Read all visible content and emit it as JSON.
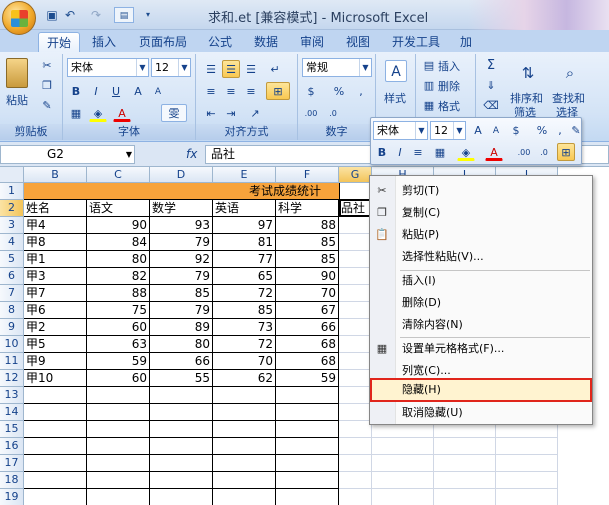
{
  "window": {
    "title": "求和.et  [兼容模式] - Microsoft Excel"
  },
  "quick_access": {
    "icons": [
      "save-icon",
      "undo-icon",
      "redo-icon",
      "customize-icon"
    ]
  },
  "tabs": [
    {
      "label": "开始",
      "active": true
    },
    {
      "label": "插入"
    },
    {
      "label": "页面布局"
    },
    {
      "label": "公式"
    },
    {
      "label": "数据"
    },
    {
      "label": "审阅"
    },
    {
      "label": "视图"
    },
    {
      "label": "开发工具"
    },
    {
      "label": "加"
    }
  ],
  "ribbon": {
    "clipboard": {
      "paste_label": "粘贴",
      "group_label": "剪贴板"
    },
    "font": {
      "name": "宋体",
      "size": "12",
      "group_label": "字体"
    },
    "alignment": {
      "group_label": "对齐方式"
    },
    "number": {
      "format": "常规",
      "group_label": "数字"
    },
    "styles": {
      "label": "样式"
    },
    "cells": {
      "insert": "插入",
      "delete": "删除",
      "format": "格式"
    },
    "editing": {
      "sort": "排序和",
      "sort2": "筛选",
      "find": "查找和",
      "find2": "选择"
    }
  },
  "formula_bar": {
    "name_box": "G2",
    "fx": "fx",
    "content": "品社"
  },
  "columns": [
    "B",
    "C",
    "D",
    "E",
    "F",
    "G",
    "H",
    "I",
    "J"
  ],
  "rows": [
    "1",
    "2",
    "3",
    "4",
    "5",
    "6",
    "7",
    "8",
    "9",
    "10",
    "11",
    "12",
    "13",
    "14",
    "15",
    "16",
    "17",
    "18",
    "19"
  ],
  "sheet": {
    "title": "考试成绩统计",
    "headers": [
      "姓名",
      "语文",
      "数学",
      "英语",
      "科学",
      "品社"
    ],
    "records": [
      [
        "甲4",
        "90",
        "93",
        "97",
        "88"
      ],
      [
        "甲8",
        "84",
        "79",
        "81",
        "85"
      ],
      [
        "甲1",
        "80",
        "92",
        "77",
        "85"
      ],
      [
        "甲3",
        "82",
        "79",
        "65",
        "90"
      ],
      [
        "甲7",
        "88",
        "85",
        "72",
        "70"
      ],
      [
        "甲6",
        "75",
        "79",
        "85",
        "67"
      ],
      [
        "甲2",
        "60",
        "89",
        "73",
        "66"
      ],
      [
        "甲5",
        "63",
        "80",
        "72",
        "68"
      ],
      [
        "甲9",
        "59",
        "66",
        "70",
        "68"
      ],
      [
        "甲10",
        "60",
        "55",
        "62",
        "59"
      ]
    ]
  },
  "mini_toolbar": {
    "font": "宋体",
    "size": "12",
    "percent": "%"
  },
  "context_menu": {
    "items": [
      {
        "label": "剪切(T)",
        "icon": "cut-icon"
      },
      {
        "label": "复制(C)",
        "icon": "copy-icon"
      },
      {
        "label": "粘贴(P)",
        "icon": "paste-icon"
      },
      {
        "label": "选择性粘贴(V)..."
      },
      {
        "label": "插入(I)"
      },
      {
        "label": "删除(D)"
      },
      {
        "label": "清除内容(N)"
      },
      {
        "label": "设置单元格格式(F)...",
        "icon": "format-cells-icon"
      },
      {
        "label": "列宽(C)..."
      },
      {
        "label": "隐藏(H)",
        "highlighted": true
      },
      {
        "label": "取消隐藏(U)"
      }
    ]
  },
  "colors": {
    "title_fill": "#f7a33b",
    "ribbon_bg": "#d3e3f6",
    "highlight_outline": "#e0251b"
  }
}
